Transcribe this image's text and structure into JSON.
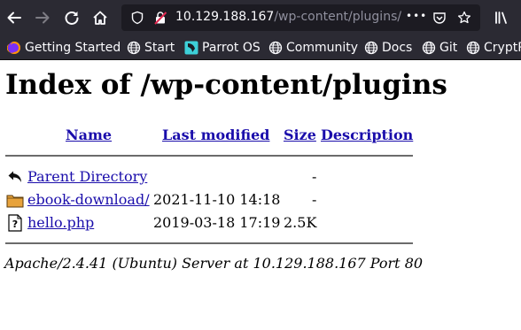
{
  "browser": {
    "url_host": "10.129.188.167",
    "url_path": "/wp-content/plugins/",
    "overflow_dots": "•••",
    "icons": {
      "back": "back-arrow-icon",
      "forward": "forward-arrow-icon",
      "reload": "reload-icon",
      "home": "home-icon",
      "security": "shield-icon",
      "insecure": "insecure-lock-icon",
      "bookmark": "star-icon",
      "library": "library-icon"
    },
    "bookmarks": [
      {
        "label": "Getting Started",
        "icon": "firefox-icon"
      },
      {
        "label": "Start",
        "icon": "globe-icon"
      },
      {
        "label": "Parrot OS",
        "icon": "parrot-icon"
      },
      {
        "label": "Community",
        "icon": "globe-icon"
      },
      {
        "label": "Docs",
        "icon": "globe-icon"
      },
      {
        "label": "Git",
        "icon": "globe-icon"
      },
      {
        "label": "CryptP",
        "icon": "globe-icon"
      }
    ]
  },
  "page": {
    "title": "Index of /wp-content/plugins",
    "columns": {
      "name": "Name",
      "last_modified": "Last modified",
      "size": "Size",
      "description": "Description"
    },
    "rows": [
      {
        "icon": "back-icon",
        "name": "Parent Directory",
        "modified": "",
        "size": "-",
        "description": ""
      },
      {
        "icon": "folder-icon",
        "name": "ebook-download/",
        "modified": "2021-11-10 14:18",
        "size": "-",
        "description": ""
      },
      {
        "icon": "unknown-file-icon",
        "name": "hello.php",
        "modified": "2019-03-18 17:19",
        "size": "2.5K",
        "description": ""
      }
    ],
    "footer": "Apache/2.4.41 (Ubuntu) Server at 10.129.188.167 Port 80"
  },
  "colors": {
    "chrome_bg": "#2b2a33",
    "urlbar_bg": "#1c1b22",
    "link": "#1a0dab",
    "rule": "#6b6b6b"
  }
}
